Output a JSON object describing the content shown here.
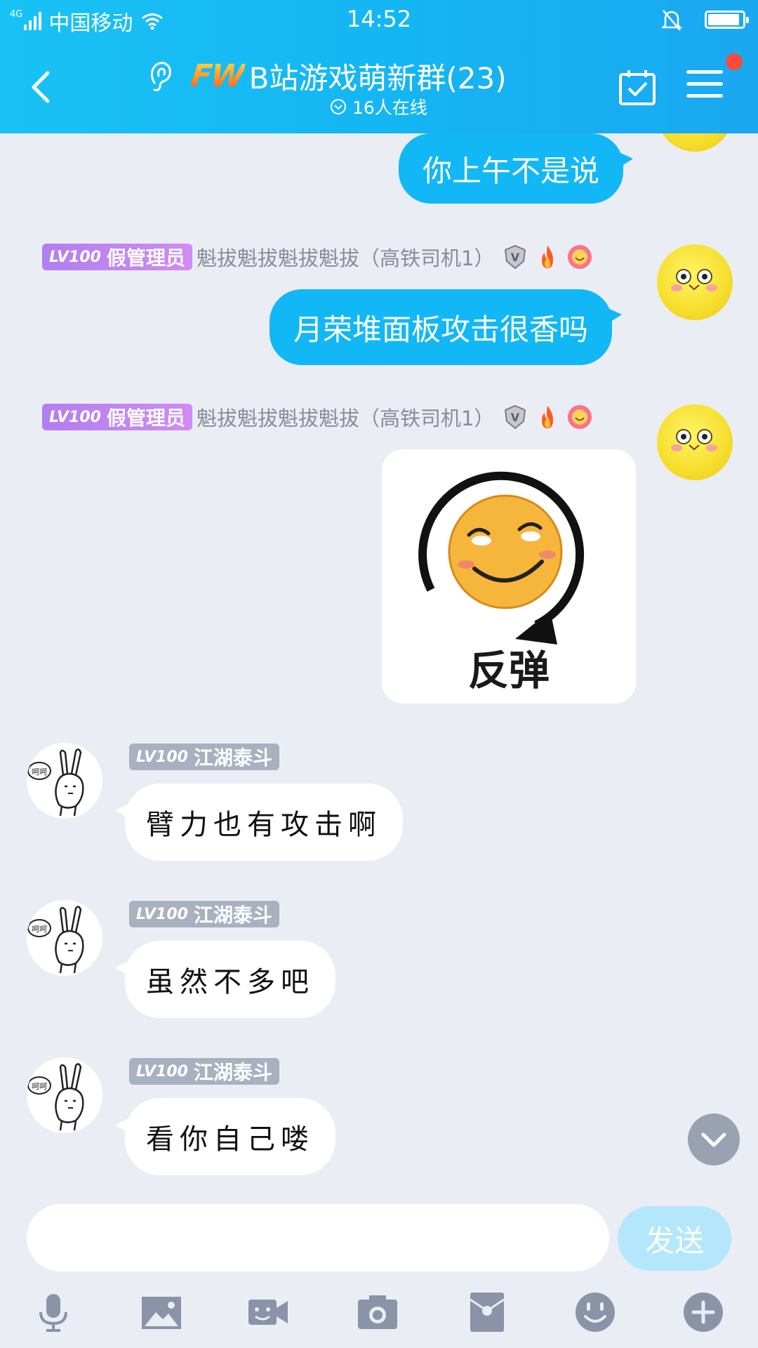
{
  "status_bar": {
    "network": "4G",
    "carrier": "中国移动",
    "time": "14:52",
    "battery_level": 0.85
  },
  "header": {
    "logo_text": "FW",
    "title": "B站游戏萌新群(23)",
    "online": "16人在线",
    "has_notification": true
  },
  "messages": [
    {
      "side": "out",
      "text": "你上午不是说"
    },
    {
      "side": "out",
      "level": "LV100",
      "title_badge": "假管理员",
      "sender": "魁拔魁拔魁拔魁拔（高铁司机1）",
      "text": "月荣堆面板攻击很香吗"
    },
    {
      "side": "out",
      "level": "LV100",
      "title_badge": "假管理员",
      "sender": "魁拔魁拔魁拔魁拔（高铁司机1）",
      "sticker_text": "反弹"
    },
    {
      "side": "in",
      "level": "LV100",
      "sender": "江湖泰斗",
      "text": "臂力也有攻击啊"
    },
    {
      "side": "in",
      "level": "LV100",
      "sender": "江湖泰斗",
      "text": "虽然不多吧"
    },
    {
      "side": "in",
      "level": "LV100",
      "sender": "江湖泰斗",
      "text": "看你自己喽"
    }
  ],
  "input": {
    "value": "",
    "placeholder": "",
    "send_label": "发送"
  },
  "toolbar": [
    "voice-icon",
    "image-icon",
    "video-call-icon",
    "camera-icon",
    "red-packet-icon",
    "emoji-icon",
    "plus-icon"
  ],
  "colors": {
    "header": "#14b6f3",
    "outgoing_bubble": "#12b7f5",
    "background": "#eaedf4",
    "send_button": "#b4e7fb",
    "admin_badge": "#c085f1"
  }
}
